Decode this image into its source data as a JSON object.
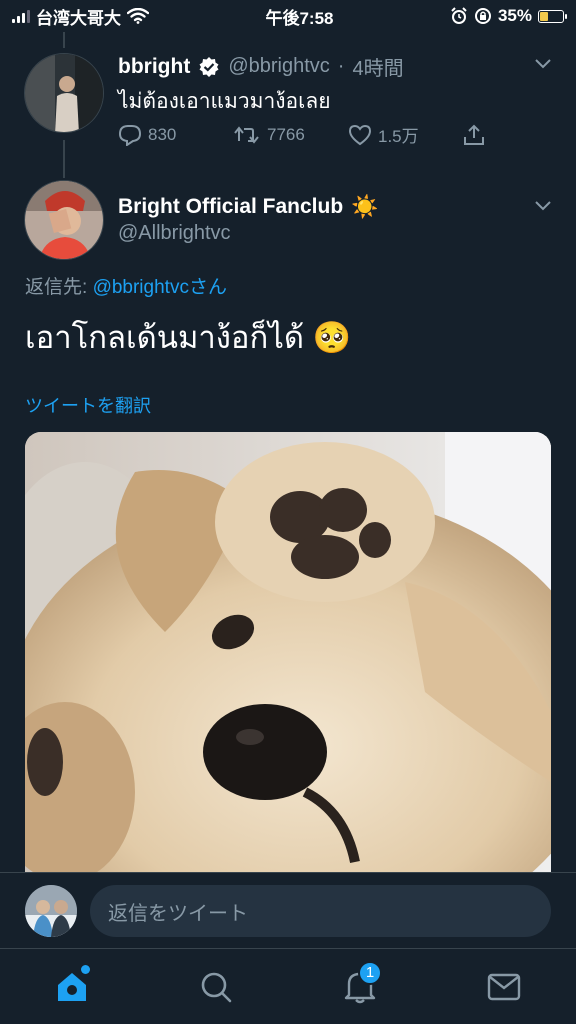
{
  "status_bar": {
    "carrier": "台湾大哥大",
    "time": "午後7:58",
    "battery": "35%",
    "battery_level": 0.35
  },
  "parent_tweet": {
    "name": "bbright",
    "handle": "@bbrightvc",
    "separator": "·",
    "time": "4時間",
    "text": "ไม่ต้องเอาแมวมาง้อเลย",
    "replies": "830",
    "retweets": "7766",
    "likes": "1.5万"
  },
  "main_tweet": {
    "name": "Bright Official Fanclub",
    "name_emoji": "☀️",
    "handle": "@Allbrightvc",
    "reply_prefix": "返信先: ",
    "reply_mention": "@bbrightvc",
    "reply_suffix": "さん",
    "text": "เอาโกลเด้นมาง้อก็ได้",
    "text_emoji": "🥺",
    "translate_label": "ツイートを翻訳"
  },
  "reply_bar": {
    "placeholder": "返信をツイート"
  },
  "tab_bar": {
    "notifications_badge": "1"
  },
  "colors": {
    "background": "#15202b",
    "accent": "#1da1f2",
    "muted": "#8899a6"
  }
}
